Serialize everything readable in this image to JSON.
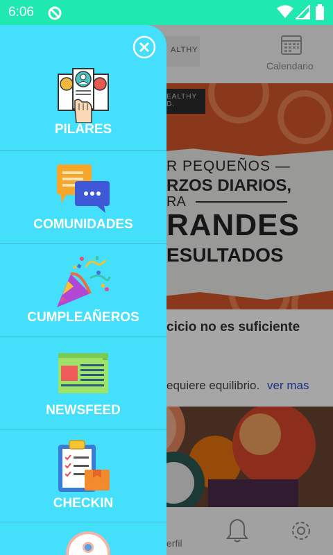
{
  "status_bar": {
    "time": "6:06"
  },
  "background": {
    "header": {
      "calendar_label": "Calendario",
      "logo_text": "ALTHY"
    },
    "banner": {
      "logo_text": "EALTHY D.",
      "line1": "R PEQUEÑOS —",
      "line2": "RZOS DIARIOS,",
      "line3": "RA",
      "line4": "RANDES",
      "line5": "ESULTADOS"
    },
    "post": {
      "title": "cicio no es suficiente",
      "excerpt": "equiere equilibrio.",
      "more_link": "ver mas"
    },
    "bottom_nav": {
      "profile_label": "erfil"
    }
  },
  "drawer": {
    "items": [
      {
        "label": "PILARES",
        "icon": "pillars-icon"
      },
      {
        "label": "COMUNIDADES",
        "icon": "chat-bubbles-icon"
      },
      {
        "label": "CUMPLEAÑEROS",
        "icon": "party-popper-icon"
      },
      {
        "label": "NEWSFEED",
        "icon": "newspaper-icon"
      },
      {
        "label": "CHECKIN",
        "icon": "clipboard-checklist-icon"
      }
    ]
  },
  "colors": {
    "status_bar": "#1fe8b0",
    "drawer": "#44e0fb",
    "link": "#2a4fc8"
  }
}
